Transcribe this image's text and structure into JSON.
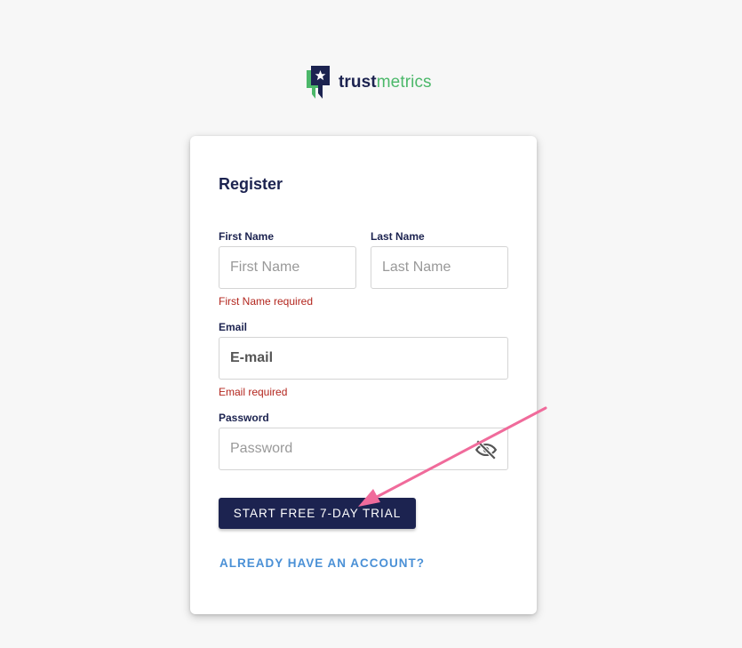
{
  "brand": {
    "name_bold": "trust",
    "name_light": "metrics",
    "logo_icon": "star-badge-icon",
    "colors": {
      "navy": "#1c2350",
      "green": "#4cb86a"
    }
  },
  "form": {
    "title": "Register",
    "first_name": {
      "label": "First Name",
      "placeholder": "First Name",
      "value": "",
      "error": "First Name required"
    },
    "last_name": {
      "label": "Last Name",
      "placeholder": "Last Name",
      "value": ""
    },
    "email": {
      "label": "Email",
      "placeholder": "E-mail",
      "value": "",
      "error": "Email required"
    },
    "password": {
      "label": "Password",
      "placeholder": "Password",
      "value": "",
      "toggle_icon": "eye-slash-icon"
    },
    "submit_label": "START FREE 7-DAY TRIAL",
    "login_link": "ALREADY HAVE AN ACCOUNT?"
  },
  "annotation": {
    "type": "arrow",
    "color": "#f06b9b"
  },
  "colors": {
    "error": "#b3261e",
    "link": "#4a90d6",
    "button_bg": "#1c2350"
  }
}
